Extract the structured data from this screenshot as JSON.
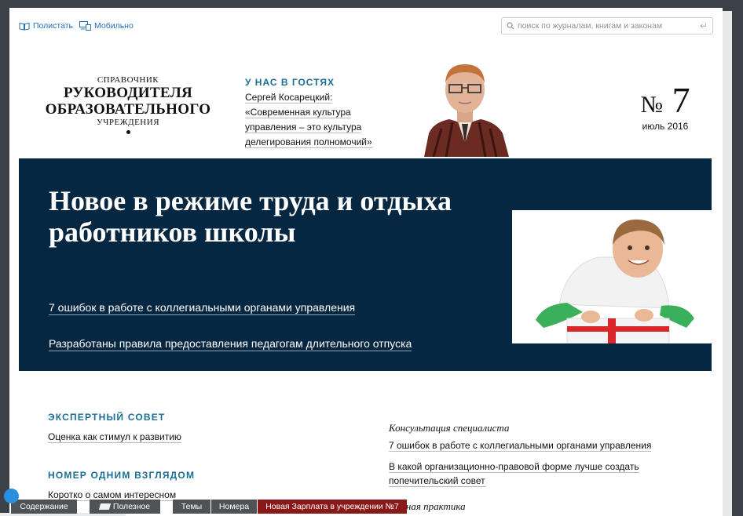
{
  "topbar": {
    "read_label": "Полистать",
    "mobile_label": "Мобильно",
    "search_placeholder": "поиск по журналам, книгам и законам"
  },
  "masthead": {
    "line1": "СПРАВОЧНИК",
    "line2": "РУКОВОДИТЕЛЯ",
    "line3": "ОБРАЗОВАТЕЛЬНОГО",
    "line4": "УЧРЕЖДЕНИЯ"
  },
  "guest": {
    "label": "У НАС В ГОСТЯХ",
    "lines": [
      "Сергей Косарецкий:",
      "«Современная культура",
      "управления – это культура",
      "делегирования полномочий»"
    ]
  },
  "issue": {
    "number_sign": "№",
    "number": "7",
    "date": "июль 2016"
  },
  "banner": {
    "headline_line1": "Новое в режиме труда и отдыха",
    "headline_line2": "работников школы",
    "links": [
      "7 ошибок в работе с коллегиальными органами управления",
      "Разработаны правила предоставления педагогам длительного отпуска"
    ]
  },
  "left_column": {
    "sections": [
      {
        "title": "ЭКСПЕРТНЫЙ СОВЕТ",
        "articles": [
          "Оценка как стимул к развитию"
        ]
      },
      {
        "title": "НОМЕР ОДНИМ ВЗГЛЯДОМ",
        "articles": [
          "Коротко о самом интересном"
        ]
      }
    ]
  },
  "right_column": {
    "rubric1": "Консультация специалиста",
    "articles": [
      "7 ошибок в работе с коллегиальными органами управления",
      "В какой организационно-правовой форме лучше создать",
      "попечительский совет"
    ],
    "rubric2": "...ебная практика"
  },
  "bottombar": {
    "contents": "Содержание",
    "useful": "Полезное",
    "themes": "Темы",
    "issues": "Номера",
    "promo": "Новая Зарплата в учреждении №7"
  },
  "colors": {
    "accent": "#1a6e93",
    "banner_bg": "#062741",
    "link": "#1f6fb5",
    "promo": "#8b1818"
  }
}
